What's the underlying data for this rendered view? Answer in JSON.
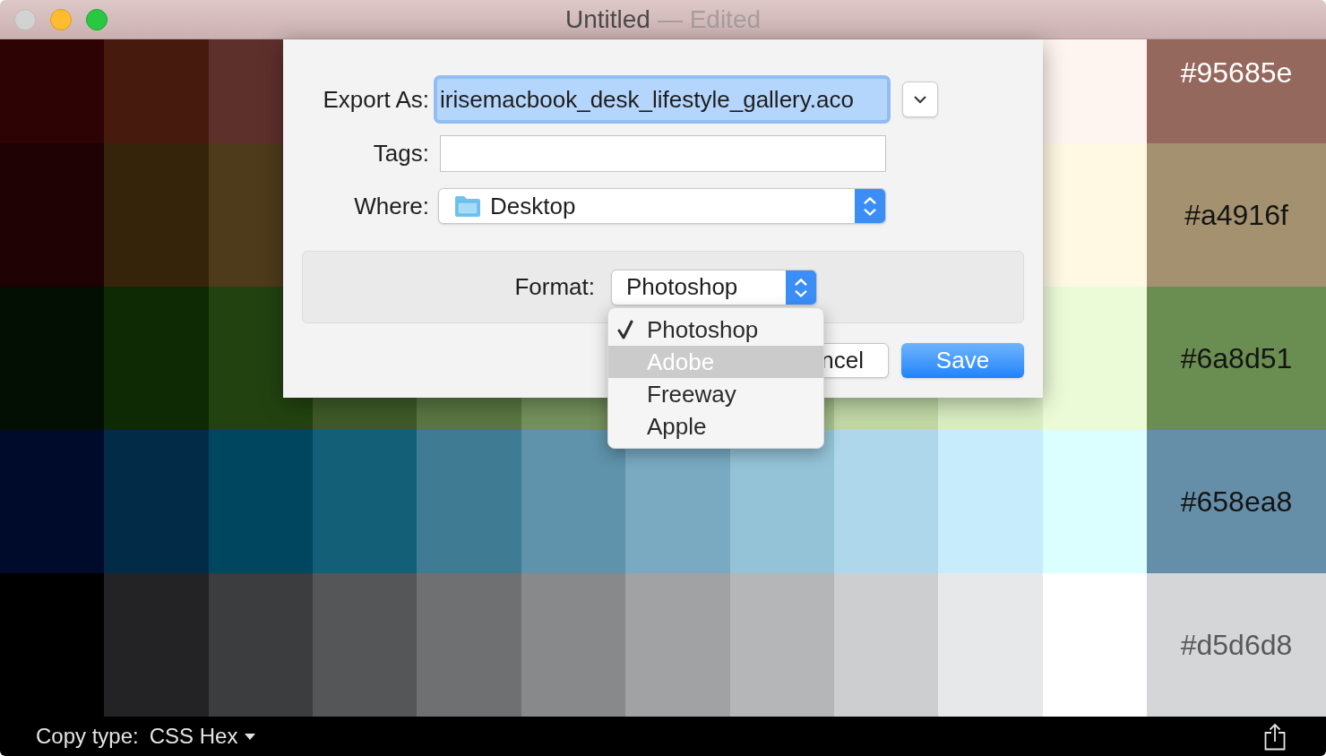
{
  "window": {
    "title": "Untitled",
    "status": "— Edited",
    "controls": [
      {
        "kind": "close",
        "disabled": true
      },
      {
        "kind": "minimize",
        "disabled": false
      },
      {
        "kind": "zoom",
        "disabled": false
      }
    ]
  },
  "palette": {
    "rows": [
      {
        "label": "#95685e",
        "color": "#95685e",
        "shades": [
          {
            "color": "#2e0303"
          },
          {
            "color": "#461b0d"
          },
          {
            "color": "#5e302c"
          }
        ],
        "shades_right": [
          {
            "color": "#fff5f0"
          }
        ]
      },
      {
        "label": "#a4916f",
        "color": "#a4916f",
        "shades": [
          {
            "color": "#1f0203"
          },
          {
            "color": "#35240a"
          },
          {
            "color": "#4e3b1b"
          }
        ],
        "shades_right": [
          {
            "color": "#fff9e4"
          }
        ]
      },
      {
        "label": "#6a8d51",
        "color": "#6a8d51",
        "shades": [
          {
            "color": "#030f02"
          },
          {
            "color": "#0d2a05"
          },
          {
            "color": "#224310"
          },
          {
            "color": "#3f5a29"
          },
          {
            "color": "#5a7642"
          },
          {
            "color": "#74915c"
          }
        ],
        "shades_right": [
          {
            "color": "#a7c28e"
          },
          {
            "color": "#c1d8a6"
          },
          {
            "color": "#d9eec2"
          },
          {
            "color": "#ecfbd7"
          }
        ]
      },
      {
        "label": "#658ea8",
        "color": "#658ea8",
        "shades": [
          {
            "color": "#000b2b"
          },
          {
            "color": "#022b47"
          },
          {
            "color": "#00465e"
          },
          {
            "color": "#135f77"
          },
          {
            "color": "#3f7b92"
          },
          {
            "color": "#5e93ab"
          },
          {
            "color": "#79aac2"
          },
          {
            "color": "#94c3d8"
          },
          {
            "color": "#aed7ec"
          },
          {
            "color": "#c7edfd"
          },
          {
            "color": "#dbfefe"
          }
        ]
      },
      {
        "label": "#d5d6d8",
        "color": "#d5d6d8",
        "shades": [
          {
            "color": "#000000"
          },
          {
            "color": "#232325"
          },
          {
            "color": "#3c3d3f"
          },
          {
            "color": "#555658"
          },
          {
            "color": "#6f7072"
          },
          {
            "color": "#88898b"
          },
          {
            "color": "#a1a2a4"
          },
          {
            "color": "#b5b6b8"
          },
          {
            "color": "#cdced0"
          },
          {
            "color": "#e7e8ea"
          },
          {
            "color": "#ffffff"
          }
        ]
      }
    ]
  },
  "export_sheet": {
    "export_as": {
      "label": "Export As:",
      "value": "irisemacbook_desk_lifestyle_gallery.aco",
      "focused": true
    },
    "expand_button": {
      "expanded": false
    },
    "tags": {
      "label": "Tags:"
    },
    "where": {
      "label": "Where:",
      "value": "Desktop"
    },
    "format": {
      "label": "Format:",
      "value": "Photoshop",
      "menu": [
        {
          "label": "Photoshop",
          "selected": true,
          "highlighted": false
        },
        {
          "label": "Adobe",
          "selected": false,
          "highlighted": true
        },
        {
          "label": "Freeway",
          "selected": false,
          "highlighted": false
        },
        {
          "label": "Apple",
          "selected": false,
          "highlighted": false
        }
      ]
    },
    "buttons": [
      {
        "kind": "cancel",
        "label": "ncel"
      },
      {
        "kind": "default",
        "label": "Save"
      }
    ]
  },
  "bottom_bar": {
    "label": "Copy type:",
    "value": "CSS Hex"
  }
}
